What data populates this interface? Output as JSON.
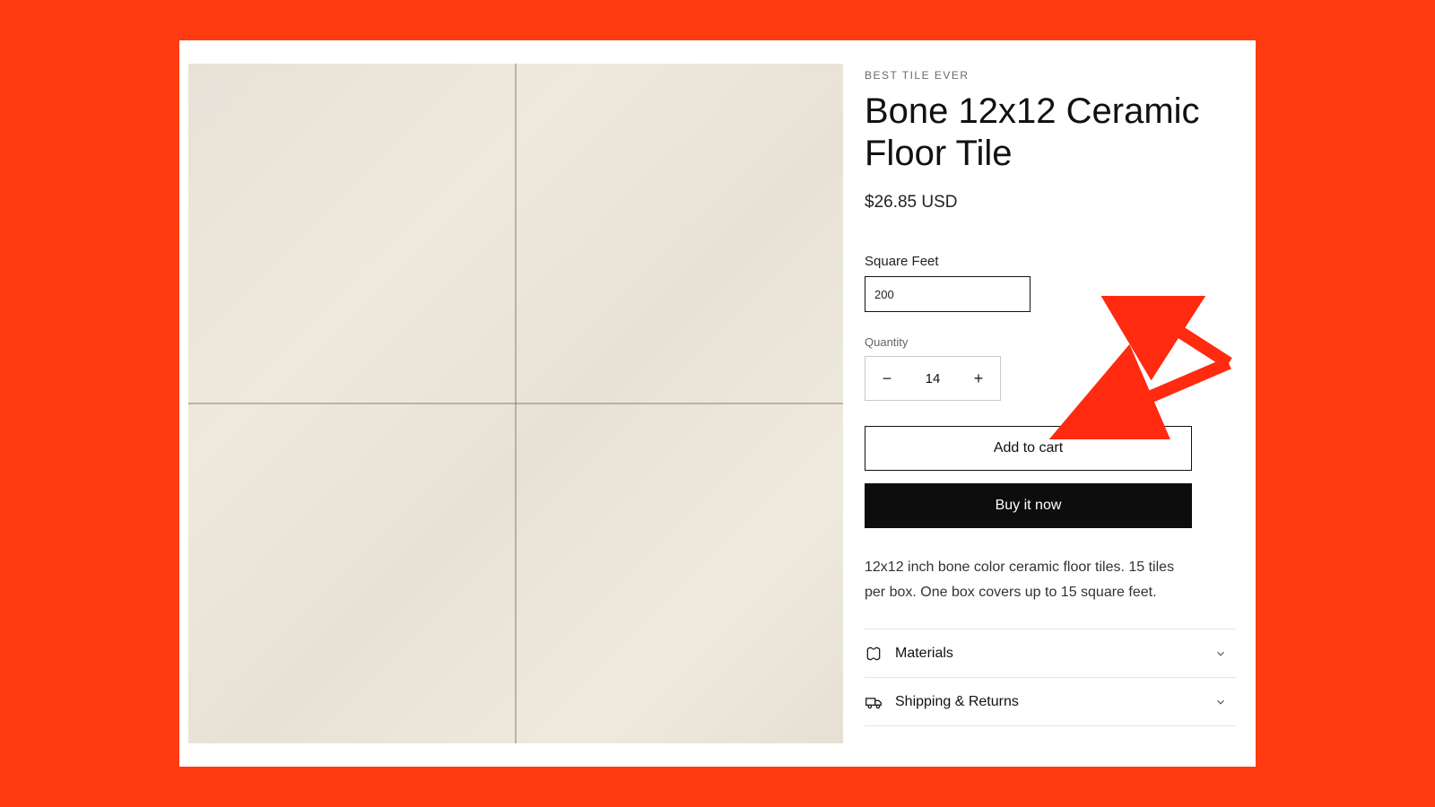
{
  "colors": {
    "accent": "#ff3b12",
    "text": "#111111"
  },
  "product": {
    "vendor": "BEST TILE EVER",
    "title": "Bone 12x12 Ceramic Floor Tile",
    "price": "$26.85 USD",
    "sqft_label": "Square Feet",
    "sqft_value": "200",
    "qty_label": "Quantity",
    "qty_value": "14",
    "add_to_cart": "Add to cart",
    "buy_now": "Buy it now",
    "description": "12x12 inch bone color ceramic floor tiles.  15 tiles per box.  One box covers up to 15 square feet."
  },
  "accordion": {
    "materials": "Materials",
    "shipping": "Shipping & Returns"
  }
}
